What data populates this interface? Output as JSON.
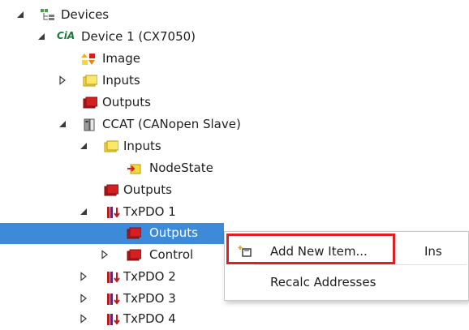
{
  "tree": {
    "devices": {
      "label": "Devices",
      "icon": "devices-tree-icon"
    },
    "device1": {
      "label": "Device 1 (CX7050)",
      "icon": "cia-icon",
      "icon_text": "CiA"
    },
    "image": {
      "label": "Image",
      "icon": "image-icon"
    },
    "inputs": {
      "label": "Inputs",
      "icon": "inputs-folder-icon"
    },
    "outputs": {
      "label": "Outputs",
      "icon": "outputs-folder-icon"
    },
    "ccat": {
      "label": "CCAT (CANopen Slave)",
      "icon": "ccat-slave-icon"
    },
    "ccat_inputs": {
      "label": "Inputs",
      "icon": "inputs-folder-icon"
    },
    "nodestate": {
      "label": "NodeState",
      "icon": "input-variable-icon"
    },
    "ccat_outputs": {
      "label": "Outputs",
      "icon": "outputs-folder-icon"
    },
    "txpdo1": {
      "label": "TxPDO 1",
      "icon": "pdo-icon"
    },
    "txpdo1_outputs": {
      "label": "Outputs",
      "icon": "outputs-folder-icon"
    },
    "txpdo1_control": {
      "label": "Control",
      "icon": "outputs-folder-icon"
    },
    "txpdo2": {
      "label": "TxPDO 2",
      "icon": "pdo-icon"
    },
    "txpdo3": {
      "label": "TxPDO 3",
      "icon": "pdo-icon"
    },
    "txpdo4": {
      "label": "TxPDO 4",
      "icon": "pdo-icon"
    }
  },
  "context_menu": {
    "add_new_item": {
      "label": "Add New Item...",
      "shortcut": "Ins",
      "icon": "add-new-item-icon"
    },
    "recalc_addresses": {
      "label": "Recalc Addresses"
    }
  },
  "colors": {
    "selection": "#3c8ad8",
    "highlight_border": "#e02020",
    "input_yellow": "#f5d93a",
    "output_red": "#d42020"
  }
}
